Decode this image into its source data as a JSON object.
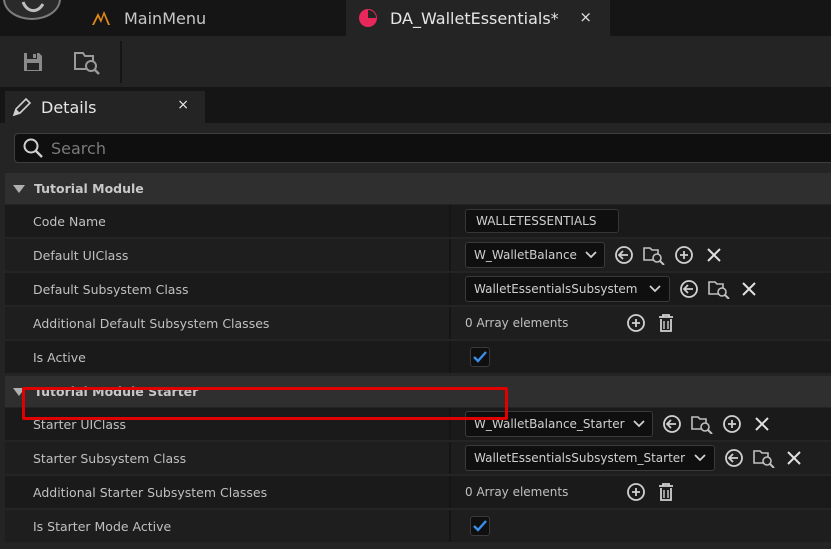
{
  "tabs": {
    "main_menu": "MainMenu",
    "asset": "DA_WalletEssentials*",
    "close": "×"
  },
  "details": {
    "title": "Details",
    "close": "×",
    "search_placeholder": "Search"
  },
  "categories": [
    {
      "label": "Tutorial Module",
      "properties": [
        {
          "name": "Code Name",
          "value": "WALLETESSENTIALS"
        },
        {
          "name": "Default UIClass",
          "value": "W_WalletBalance"
        },
        {
          "name": "Default Subsystem Class",
          "value": "WalletEssentialsSubsystem"
        },
        {
          "name": "Additional Default Subsystem Classes",
          "value": "0 Array elements"
        },
        {
          "name": "Is Active",
          "checked": true
        }
      ]
    },
    {
      "label": "Tutorial Module Starter",
      "properties": [
        {
          "name": "Starter UIClass",
          "value": "W_WalletBalance_Starter"
        },
        {
          "name": "Starter Subsystem Class",
          "value": "WalletEssentialsSubsystem_Starter"
        },
        {
          "name": "Additional Starter Subsystem Classes",
          "value": "0 Array elements"
        },
        {
          "name": "Is Starter Mode Active",
          "checked": true
        }
      ]
    }
  ],
  "colors": {
    "accent_blue": "#3a8fe8",
    "highlight_red": "#e00000",
    "asset_icon": "#e8285a",
    "level_icon": "#e08a1a"
  }
}
